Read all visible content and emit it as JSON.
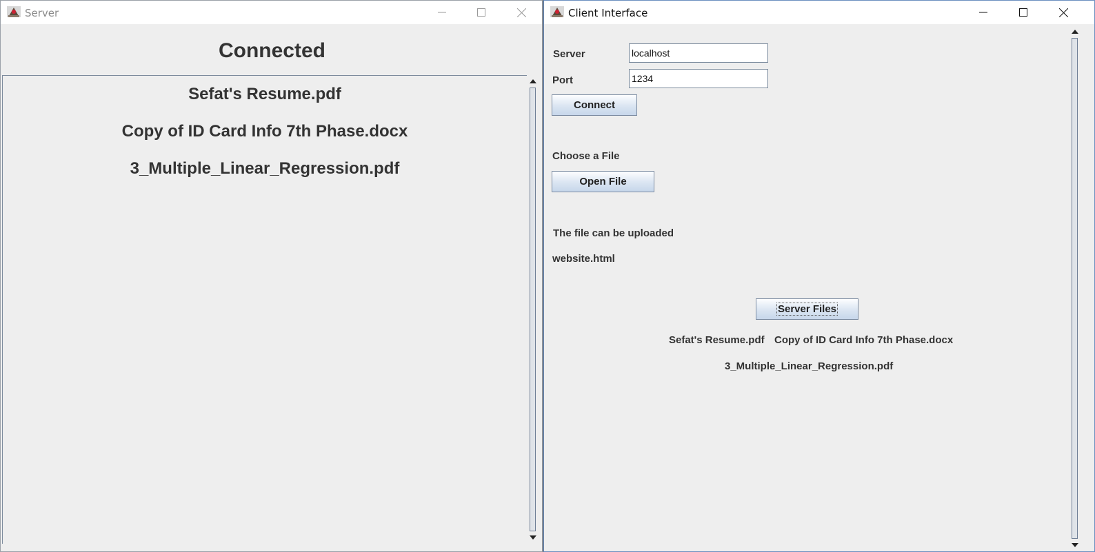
{
  "server_window": {
    "title": "Server",
    "status": "Connected",
    "files": [
      "Sefat's Resume.pdf",
      "Copy of ID Card Info 7th Phase.docx",
      "3_Multiple_Linear_Regression.pdf"
    ]
  },
  "client_window": {
    "title": "Client Interface",
    "server_label": "Server",
    "server_value": "localhost",
    "port_label": "Port",
    "port_value": "1234",
    "connect_label": "Connect",
    "choose_label": "Choose a File",
    "open_label": "Open File",
    "upload_status": "The file can be uploaded",
    "selected_file": "website.html",
    "server_files_label": "Server Files",
    "server_files": [
      "Sefat's Resume.pdf",
      "Copy of ID Card Info 7th Phase.docx",
      "3_Multiple_Linear_Regression.pdf"
    ]
  },
  "icons": {
    "app": "java-app-icon",
    "minimize": "minimize-icon",
    "maximize": "maximize-icon",
    "close": "close-icon",
    "scroll_up": "arrow-up-icon",
    "scroll_down": "arrow-down-icon"
  },
  "colors": {
    "panel_bg": "#eeeeee",
    "titlebar_bg": "#ffffff",
    "text": "#333333",
    "inactive_title": "#8a8a8a",
    "button_gradient_bottom": "#c6d6ea"
  }
}
